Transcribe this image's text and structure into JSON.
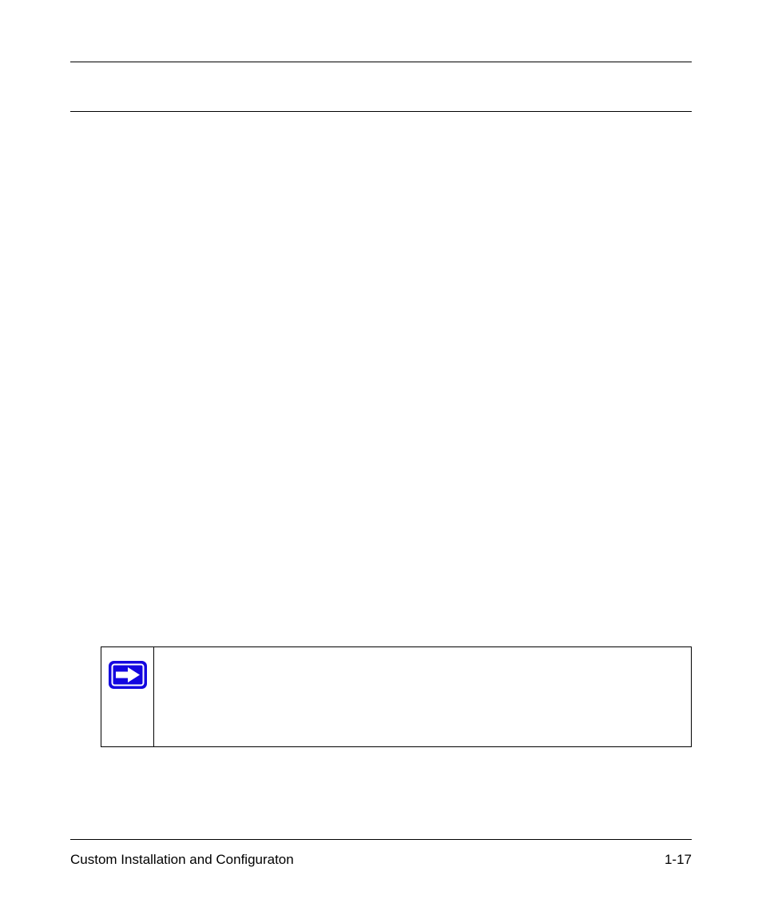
{
  "footer": {
    "section_title": "Custom Installation and Configuraton",
    "page_number": "1-17"
  },
  "note_icon": {
    "name": "arrow-right-icon"
  }
}
